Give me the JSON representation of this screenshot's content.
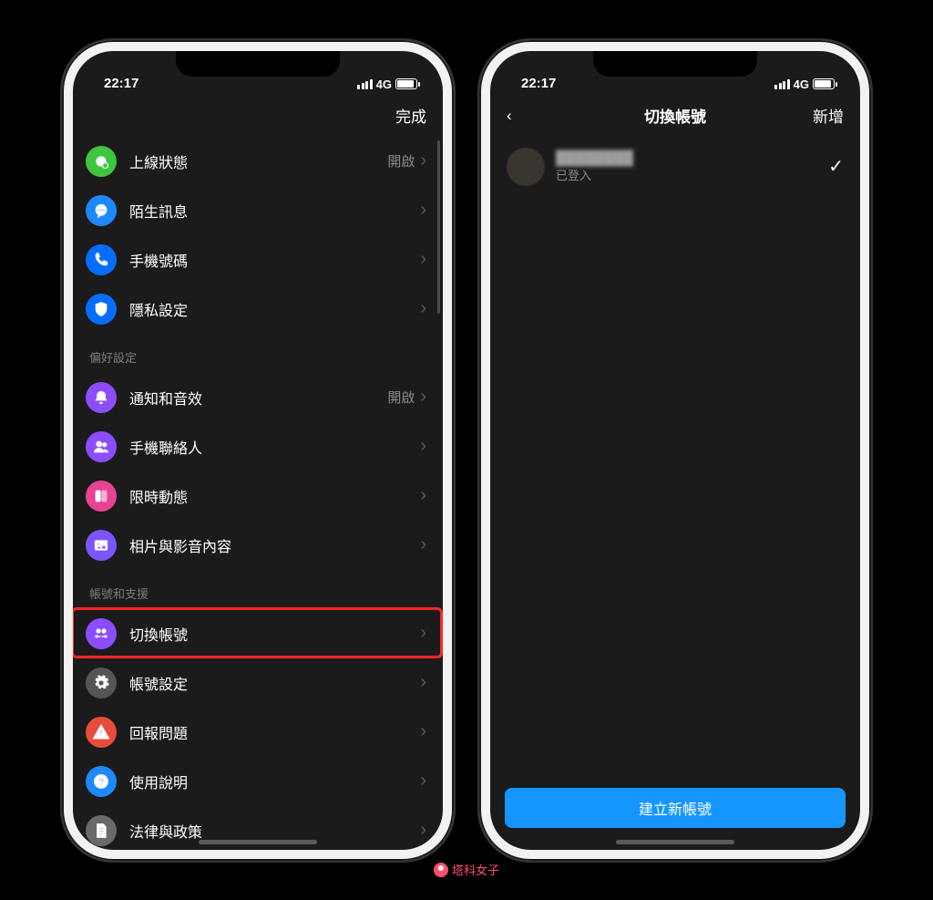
{
  "statusbar": {
    "time": "22:17",
    "network": "4G"
  },
  "left_screen": {
    "nav_done": "完成",
    "sections": [
      {
        "header": null,
        "rows": [
          {
            "id": "online-status",
            "icon": "dot-icon",
            "bg": "bg-green",
            "label": "上線狀態",
            "value": "開啟"
          },
          {
            "id": "stranger-msg",
            "icon": "chat-icon",
            "bg": "bg-blue",
            "label": "陌生訊息",
            "value": ""
          },
          {
            "id": "phone-number",
            "icon": "phone-icon",
            "bg": "bg-darkblue",
            "label": "手機號碼",
            "value": ""
          },
          {
            "id": "privacy",
            "icon": "shield-icon",
            "bg": "bg-darkblue",
            "label": "隱私設定",
            "value": ""
          }
        ]
      },
      {
        "header": "偏好設定",
        "rows": [
          {
            "id": "notifications",
            "icon": "bell-icon",
            "bg": "bg-purple",
            "label": "通知和音效",
            "value": "開啟"
          },
          {
            "id": "contacts",
            "icon": "people-icon",
            "bg": "bg-purple2",
            "label": "手機聯絡人",
            "value": ""
          },
          {
            "id": "stories",
            "icon": "story-icon",
            "bg": "bg-pink",
            "label": "限時動態",
            "value": ""
          },
          {
            "id": "media",
            "icon": "image-icon",
            "bg": "bg-violet",
            "label": "相片與影音內容",
            "value": ""
          }
        ]
      },
      {
        "header": "帳號和支援",
        "rows": [
          {
            "id": "switch-account",
            "icon": "switch-icon",
            "bg": "bg-purple",
            "label": "切換帳號",
            "value": "",
            "highlighted": true
          },
          {
            "id": "account-settings",
            "icon": "gear-icon",
            "bg": "bg-gray",
            "label": "帳號設定",
            "value": ""
          },
          {
            "id": "report",
            "icon": "warning-icon",
            "bg": "bg-red",
            "label": "回報問題",
            "value": ""
          },
          {
            "id": "help",
            "icon": "question-icon",
            "bg": "bg-cyan",
            "label": "使用說明",
            "value": ""
          },
          {
            "id": "legal",
            "icon": "doc-icon",
            "bg": "bg-gray2",
            "label": "法律與政策",
            "value": ""
          }
        ]
      }
    ]
  },
  "right_screen": {
    "nav_title": "切換帳號",
    "nav_add": "新增",
    "account": {
      "name_redacted": "████████",
      "status": "已登入"
    },
    "cta": "建立新帳號"
  },
  "watermark": "塔科女子"
}
